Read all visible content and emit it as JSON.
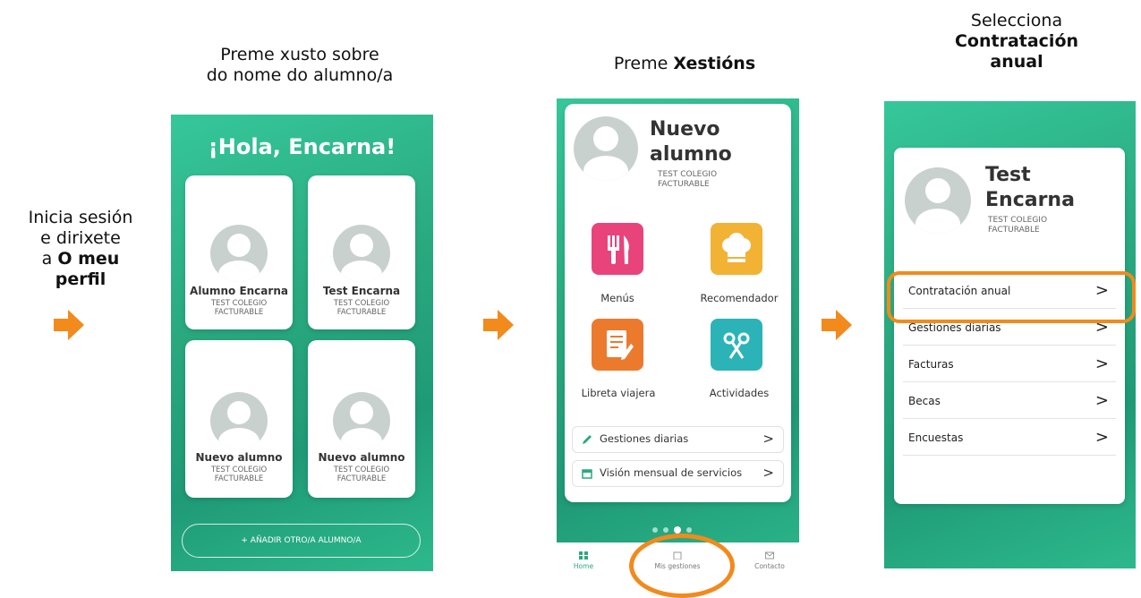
{
  "captions": {
    "step1": {
      "line1": "Inicia sesión",
      "line2": "e dirixete",
      "line3_prefix": "a ",
      "line3_bold": "O meu",
      "line4_bold": "perfil"
    },
    "step2": {
      "line1": "Preme xusto sobre",
      "line2": "do nome do alumno/a"
    },
    "step3": {
      "prefix": "Preme ",
      "bold": "Xestións"
    },
    "step4": {
      "line1": "Selecciona",
      "line2_bold": "Contratación",
      "line3_bold": "anual"
    }
  },
  "phone1": {
    "greeting": "¡Hola, Encarna!",
    "students": [
      {
        "name": "Alumno Encarna",
        "school1": "TEST COLEGIO",
        "school2": "FACTURABLE"
      },
      {
        "name": "Test Encarna",
        "school1": "TEST COLEGIO",
        "school2": "FACTURABLE"
      },
      {
        "name": "Nuevo alumno",
        "school1": "TEST COLEGIO",
        "school2": "FACTURABLE"
      },
      {
        "name": "Nuevo alumno",
        "school1": "TEST COLEGIO",
        "school2": "FACTURABLE"
      }
    ],
    "add_button": "+ AÑADIR OTRO/A ALUMNO/A"
  },
  "phone2": {
    "student_name_1": "Nuevo",
    "student_name_2": "alumno",
    "school1": "TEST COLEGIO",
    "school2": "FACTURABLE",
    "tiles": [
      {
        "label": "Menús",
        "color": "#e9437c",
        "icon": "fork-knife-icon"
      },
      {
        "label": "Recomendador",
        "color": "#f2b233",
        "icon": "chef-hat-icon"
      },
      {
        "label": "Libreta viajera",
        "color": "#ec7a2d",
        "icon": "notebook-icon"
      },
      {
        "label": "Actividades",
        "color": "#2bb3b8",
        "icon": "scissors-icon"
      }
    ],
    "rows": [
      {
        "label": "Gestiones diarias",
        "icon": "pencil-icon"
      },
      {
        "label": "Visión mensual de servicios",
        "icon": "calendar-icon"
      }
    ],
    "nav": [
      {
        "label": "Home",
        "icon": "grid-icon"
      },
      {
        "label": "Mis gestiones",
        "icon": "clipboard-icon"
      },
      {
        "label": "Contacto",
        "icon": "mail-icon"
      }
    ]
  },
  "phone3": {
    "student_name_1": "Test",
    "student_name_2": "Encarna",
    "school1": "TEST COLEGIO",
    "school2": "FACTURABLE",
    "rows": [
      {
        "label": "Contratación anual"
      },
      {
        "label": "Gestiones diarias"
      },
      {
        "label": "Facturas"
      },
      {
        "label": "Becas"
      },
      {
        "label": "Encuestas"
      }
    ],
    "chevron": ">"
  },
  "colors": {
    "accent": "#f28a1c",
    "green": "#2aa97f"
  }
}
